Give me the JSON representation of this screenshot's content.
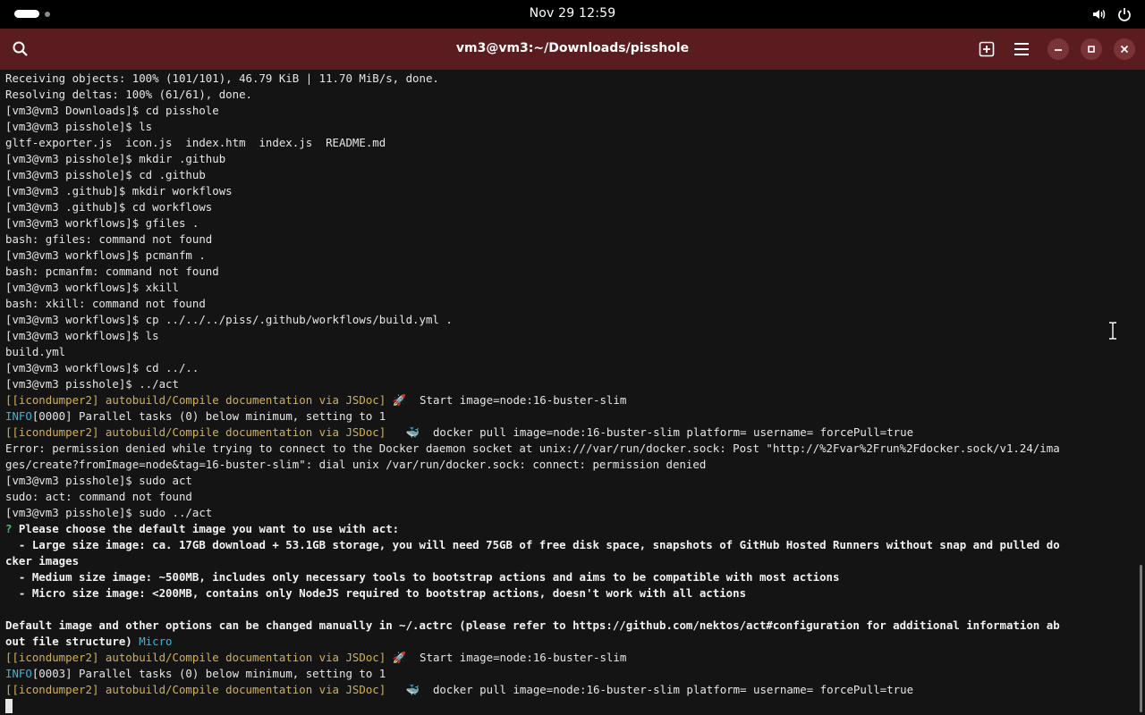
{
  "system_bar": {
    "clock": "Nov 29  12:59",
    "icons": [
      "activities-indicator",
      "volume-icon",
      "power-icon"
    ]
  },
  "window": {
    "title": "vm3@vm3:~/Downloads/pisshole",
    "buttons": [
      "search-icon",
      "new-tab-icon",
      "hamburger-menu-icon",
      "minimize-icon",
      "maximize-icon",
      "close-icon"
    ],
    "accent_color": "#5b1c20"
  },
  "colors": {
    "background": "#141414",
    "text": "#e6e6e6",
    "yellow": "#d4b14b",
    "cyan": "#3bb6d6",
    "green": "#45c56a"
  },
  "terminal": {
    "lines": [
      [
        {
          "t": "Receiving objects: 100% (101/101), 46.79 KiB | 11.70 MiB/s, done."
        }
      ],
      [
        {
          "t": "Resolving deltas: 100% (61/61), done."
        }
      ],
      [
        {
          "t": "[vm3@vm3 Downloads]$ cd pisshole"
        }
      ],
      [
        {
          "t": "[vm3@vm3 pisshole]$ ls"
        }
      ],
      [
        {
          "t": "gltf-exporter.js  icon.js  index.htm  index.js  README.md"
        }
      ],
      [
        {
          "t": "[vm3@vm3 pisshole]$ mkdir .github"
        }
      ],
      [
        {
          "t": "[vm3@vm3 pisshole]$ cd .github"
        }
      ],
      [
        {
          "t": "[vm3@vm3 .github]$ mkdir workflows"
        }
      ],
      [
        {
          "t": "[vm3@vm3 .github]$ cd workflows"
        }
      ],
      [
        {
          "t": "[vm3@vm3 workflows]$ gfiles ."
        }
      ],
      [
        {
          "t": "bash: gfiles: command not found"
        }
      ],
      [
        {
          "t": "[vm3@vm3 workflows]$ pcmanfm ."
        }
      ],
      [
        {
          "t": "bash: pcmanfm: command not found"
        }
      ],
      [
        {
          "t": "[vm3@vm3 workflows]$ xkill"
        }
      ],
      [
        {
          "t": "bash: xkill: command not found"
        }
      ],
      [
        {
          "t": "[vm3@vm3 workflows]$ cp ../../../piss/.github/workflows/build.yml ."
        }
      ],
      [
        {
          "t": "[vm3@vm3 workflows]$ ls"
        }
      ],
      [
        {
          "t": "build.yml"
        }
      ],
      [
        {
          "t": "[vm3@vm3 workflows]$ cd ../.."
        }
      ],
      [
        {
          "t": "[vm3@vm3 pisshole]$ ../act"
        }
      ],
      [
        {
          "t": "[[icondumper2] autobuild/Compile documentation via JSDoc]",
          "c": "yellow"
        },
        {
          "t": " 🚀  Start image=node:16-buster-slim"
        }
      ],
      [
        {
          "t": "INFO",
          "c": "cyan"
        },
        {
          "t": "[0000] Parallel tasks (0) below minimum, setting to 1"
        }
      ],
      [
        {
          "t": "[[icondumper2] autobuild/Compile documentation via JSDoc]",
          "c": "yellow"
        },
        {
          "t": "   🐳  docker pull image=node:16-buster-slim platform= username= forcePull=true"
        }
      ],
      [
        {
          "t": "Error: permission denied while trying to connect to the Docker daemon socket at unix:///var/run/docker.sock: Post \"http://%2Fvar%2Frun%2Fdocker.sock/v1.24/ima"
        }
      ],
      [
        {
          "t": "ges/create?fromImage=node&tag=16-buster-slim\": dial unix /var/run/docker.sock: connect: permission denied"
        }
      ],
      [
        {
          "t": "[vm3@vm3 pisshole]$ sudo act"
        }
      ],
      [
        {
          "t": "sudo: act: command not found"
        }
      ],
      [
        {
          "t": "[vm3@vm3 pisshole]$ sudo ../act"
        }
      ],
      [
        {
          "t": "?",
          "c": "green"
        },
        {
          "t": " Please choose the default image you want to use with act:",
          "c": "bold"
        }
      ],
      [
        {
          "t": "  - Large size image: ca. 17GB download + 53.1GB storage, you will need 75GB of free disk space, snapshots of GitHub Hosted Runners without snap and pulled do",
          "c": "bold"
        }
      ],
      [
        {
          "t": "cker images",
          "c": "bold"
        }
      ],
      [
        {
          "t": "  - Medium size image: ~500MB, includes only necessary tools to bootstrap actions and aims to be compatible with most actions",
          "c": "bold"
        }
      ],
      [
        {
          "t": "  - Micro size image: <200MB, contains only NodeJS required to bootstrap actions, doesn't work with all actions",
          "c": "bold"
        }
      ],
      [
        {
          "t": ""
        }
      ],
      [
        {
          "t": "Default image and other options can be changed manually in ~/.actrc (please refer to https://github.com/nektos/act#configuration for additional information ab",
          "c": "bold"
        }
      ],
      [
        {
          "t": "out file structure)",
          "c": "bold"
        },
        {
          "t": " Micro",
          "c": "cyan"
        }
      ],
      [
        {
          "t": "[[icondumper2] autobuild/Compile documentation via JSDoc]",
          "c": "yellow"
        },
        {
          "t": " 🚀  Start image=node:16-buster-slim"
        }
      ],
      [
        {
          "t": "INFO",
          "c": "cyan"
        },
        {
          "t": "[0003] Parallel tasks (0) below minimum, setting to 1"
        }
      ],
      [
        {
          "t": "[[icondumper2] autobuild/Compile documentation via JSDoc]",
          "c": "yellow"
        },
        {
          "t": "   🐳  docker pull image=node:16-buster-slim platform= username= forcePull=true"
        }
      ]
    ]
  }
}
